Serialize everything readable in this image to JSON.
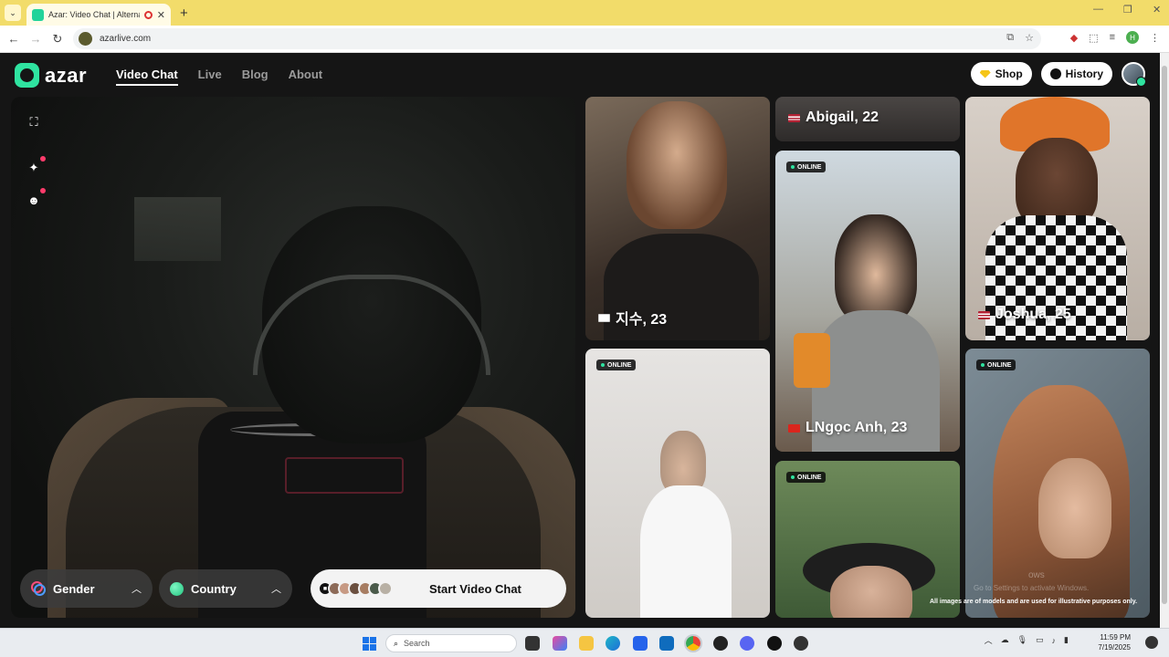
{
  "browser": {
    "tab_title": "Azar: Video Chat | Alternati",
    "url": "azarlive.com"
  },
  "header": {
    "logo_text": "azar",
    "nav": [
      {
        "label": "Video Chat",
        "active": true
      },
      {
        "label": "Live",
        "active": false
      },
      {
        "label": "Blog",
        "active": false
      },
      {
        "label": "About",
        "active": false
      }
    ],
    "shop_label": "Shop",
    "history_label": "History"
  },
  "controls": {
    "gender_label": "Gender",
    "country_label": "Country",
    "start_label": "Start Video Chat"
  },
  "profiles": [
    {
      "name": "지수, 23",
      "flag": "kr",
      "online": false
    },
    {
      "name": "Abigail, 22",
      "flag": "us",
      "online": false
    },
    {
      "name": "Joshua, 25",
      "flag": "us",
      "online": false
    },
    {
      "name": "LNgọc Anh, 23",
      "flag": "vn",
      "online": true
    },
    {
      "name": "",
      "flag": "",
      "online": true
    },
    {
      "name": "",
      "flag": "",
      "online": true
    },
    {
      "name": "",
      "flag": "",
      "online": true
    }
  ],
  "online_label": "ONLINE",
  "disclaimer": "All images are of models and are used for illustrative purposes only.",
  "watermark": {
    "line1": "ows",
    "line2": "Go to Settings to activate Windows."
  },
  "taskbar": {
    "search_placeholder": "Search",
    "time": "11:59 PM",
    "date": "7/19/2025"
  },
  "colors": {
    "accent": "#2fe3a0",
    "background": "#151515",
    "tabbar": "#f2dc6a"
  }
}
